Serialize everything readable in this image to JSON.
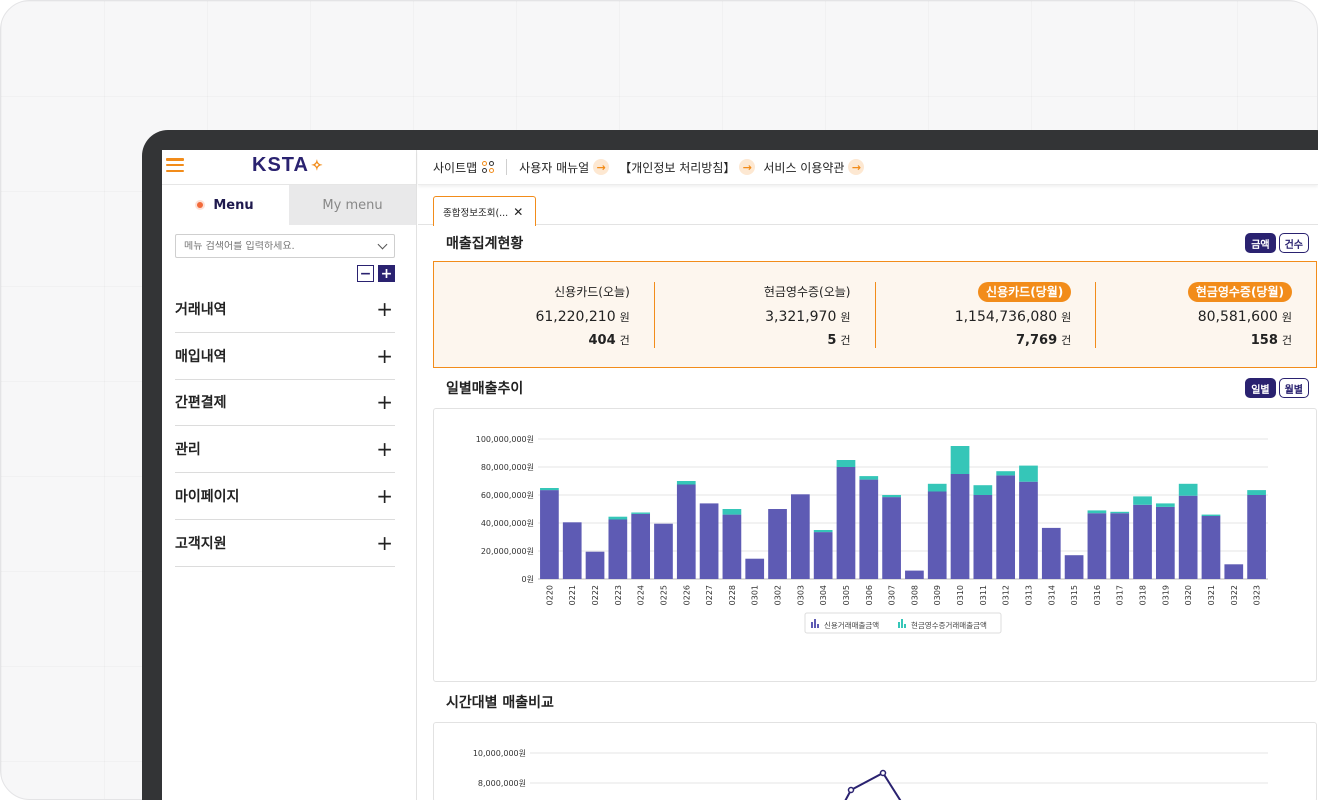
{
  "logo": {
    "text": "KSTA",
    "mark": "✧"
  },
  "sidebar": {
    "tabs": [
      {
        "label": "Menu"
      },
      {
        "label": "My menu"
      }
    ],
    "search_placeholder": "메뉴 검색어를 입력하세요.",
    "items": [
      {
        "label": "거래내역"
      },
      {
        "label": "매입내역"
      },
      {
        "label": "간편결제"
      },
      {
        "label": "관리"
      },
      {
        "label": "마이페이지"
      },
      {
        "label": "고객지원"
      }
    ]
  },
  "topbar": {
    "sitemap": "사이트맵",
    "manual": "사용자 매뉴얼",
    "privacy": "【개인정보 처리방침】",
    "terms": "서비스 이용약관"
  },
  "page_tab": {
    "label": "종합정보조회(..."
  },
  "summary": {
    "title": "매출집계현황",
    "toggle": [
      "금액",
      "건수"
    ],
    "amount_unit": "원",
    "count_unit": "건",
    "columns": [
      {
        "label": "신용카드(오늘)",
        "amount": "61,220,210",
        "count": "404",
        "highlight": false
      },
      {
        "label": "현금영수증(오늘)",
        "amount": "3,321,970",
        "count": "5",
        "highlight": false
      },
      {
        "label": "신용카드(당월)",
        "amount": "1,154,736,080",
        "count": "7,769",
        "highlight": true
      },
      {
        "label": "현금영수증(당월)",
        "amount": "80,581,600",
        "count": "158",
        "highlight": true
      }
    ]
  },
  "daily": {
    "title": "일별매출추이",
    "toggle": [
      "일별",
      "월별"
    ]
  },
  "hourly": {
    "title": "시간대별 매출비교"
  },
  "colors": {
    "accent": "#f28c1a",
    "navy": "#2a2270",
    "credit": "#5e5bb4",
    "cash": "#35c6b8"
  },
  "chart_data": [
    {
      "type": "bar",
      "stacked": true,
      "categories": [
        "0220",
        "0221",
        "0222",
        "0223",
        "0224",
        "0225",
        "0226",
        "0227",
        "0228",
        "0301",
        "0302",
        "0303",
        "0304",
        "0305",
        "0306",
        "0307",
        "0308",
        "0309",
        "0310",
        "0311",
        "0312",
        "0313",
        "0314",
        "0315",
        "0316",
        "0317",
        "0318",
        "0319",
        "0320",
        "0321",
        "0322",
        "0323"
      ],
      "series": [
        {
          "name": "신용거래매출금액",
          "values": [
            63500000,
            40500000,
            19500000,
            42500000,
            46500000,
            39500000,
            67500000,
            54000000,
            46000000,
            14500000,
            50000000,
            60500000,
            33500000,
            80000000,
            71000000,
            58500000,
            6000000,
            62500000,
            75000000,
            60000000,
            74000000,
            69500000,
            36500000,
            17000000,
            47000000,
            47000000,
            53000000,
            51500000,
            59500000,
            45000000,
            10500000,
            60000000
          ]
        },
        {
          "name": "현금영수증거래매출금액",
          "values": [
            1500000,
            0,
            0,
            2000000,
            1000000,
            0,
            2500000,
            0,
            4000000,
            0,
            0,
            0,
            1500000,
            5000000,
            2500000,
            1500000,
            0,
            5500000,
            20000000,
            7000000,
            3000000,
            11500000,
            0,
            0,
            2000000,
            1000000,
            6000000,
            2500000,
            8500000,
            1000000,
            0,
            3500000
          ]
        }
      ],
      "ylim": [
        0,
        100000000
      ],
      "yticks": [
        "0원",
        "20,000,000원",
        "40,000,000원",
        "60,000,000원",
        "80,000,000원",
        "100,000,000원"
      ],
      "legend": "bottom"
    },
    {
      "type": "line",
      "yticks": [
        "8,000,000원",
        "10,000,000원"
      ],
      "ylim": [
        8000000,
        10000000
      ]
    }
  ]
}
